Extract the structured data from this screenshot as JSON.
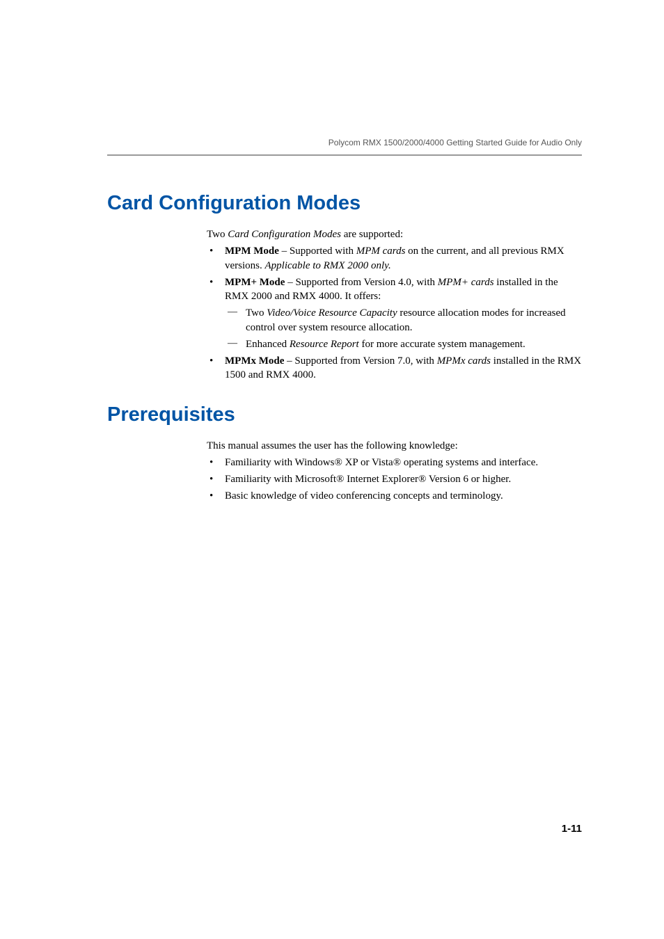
{
  "header": {
    "title": "Polycom RMX 1500/2000/4000 Getting Started Guide for Audio Only"
  },
  "section1": {
    "heading": "Card Configuration Modes",
    "intro_prefix": "Two ",
    "intro_italic": "Card Configuration Modes",
    "intro_suffix": " are supported:",
    "b1_bold": "MPM Mode",
    "b1_t1": " – Supported with ",
    "b1_i1": "MPM cards",
    "b1_t2": " on the current, and all previous RMX versions. ",
    "b1_i2": "Applicable to RMX 2000 only.",
    "b2_bold": "MPM+ Mode",
    "b2_t1": " – Supported from Version 4.0, with ",
    "b2_i1": "MPM+ cards",
    "b2_t2": " installed in the RMX 2000 and RMX 4000. It offers:",
    "b2s1_t1": "Two ",
    "b2s1_i1": "Video/Voice Resource Capacity",
    "b2s1_t2": " resource allocation modes for increased control over system resource allocation.",
    "b2s2_t1": "Enhanced ",
    "b2s2_i1": "Resource Report",
    "b2s2_t2": " for more accurate system management.",
    "b3_bold": "MPMx Mode",
    "b3_t1": " – Supported from Version 7.0, with ",
    "b3_i1": "MPMx cards",
    "b3_t2": " installed in the RMX 1500 and RMX 4000."
  },
  "section2": {
    "heading": "Prerequisites",
    "intro": "This manual assumes the user has the following knowledge:",
    "b1": "Familiarity with Windows® XP or Vista® operating systems and interface.",
    "b2": "Familiarity with Microsoft® Internet Explorer® Version 6 or higher.",
    "b3": "Basic knowledge of video conferencing concepts and terminology."
  },
  "footer": {
    "page_number": "1-11"
  }
}
